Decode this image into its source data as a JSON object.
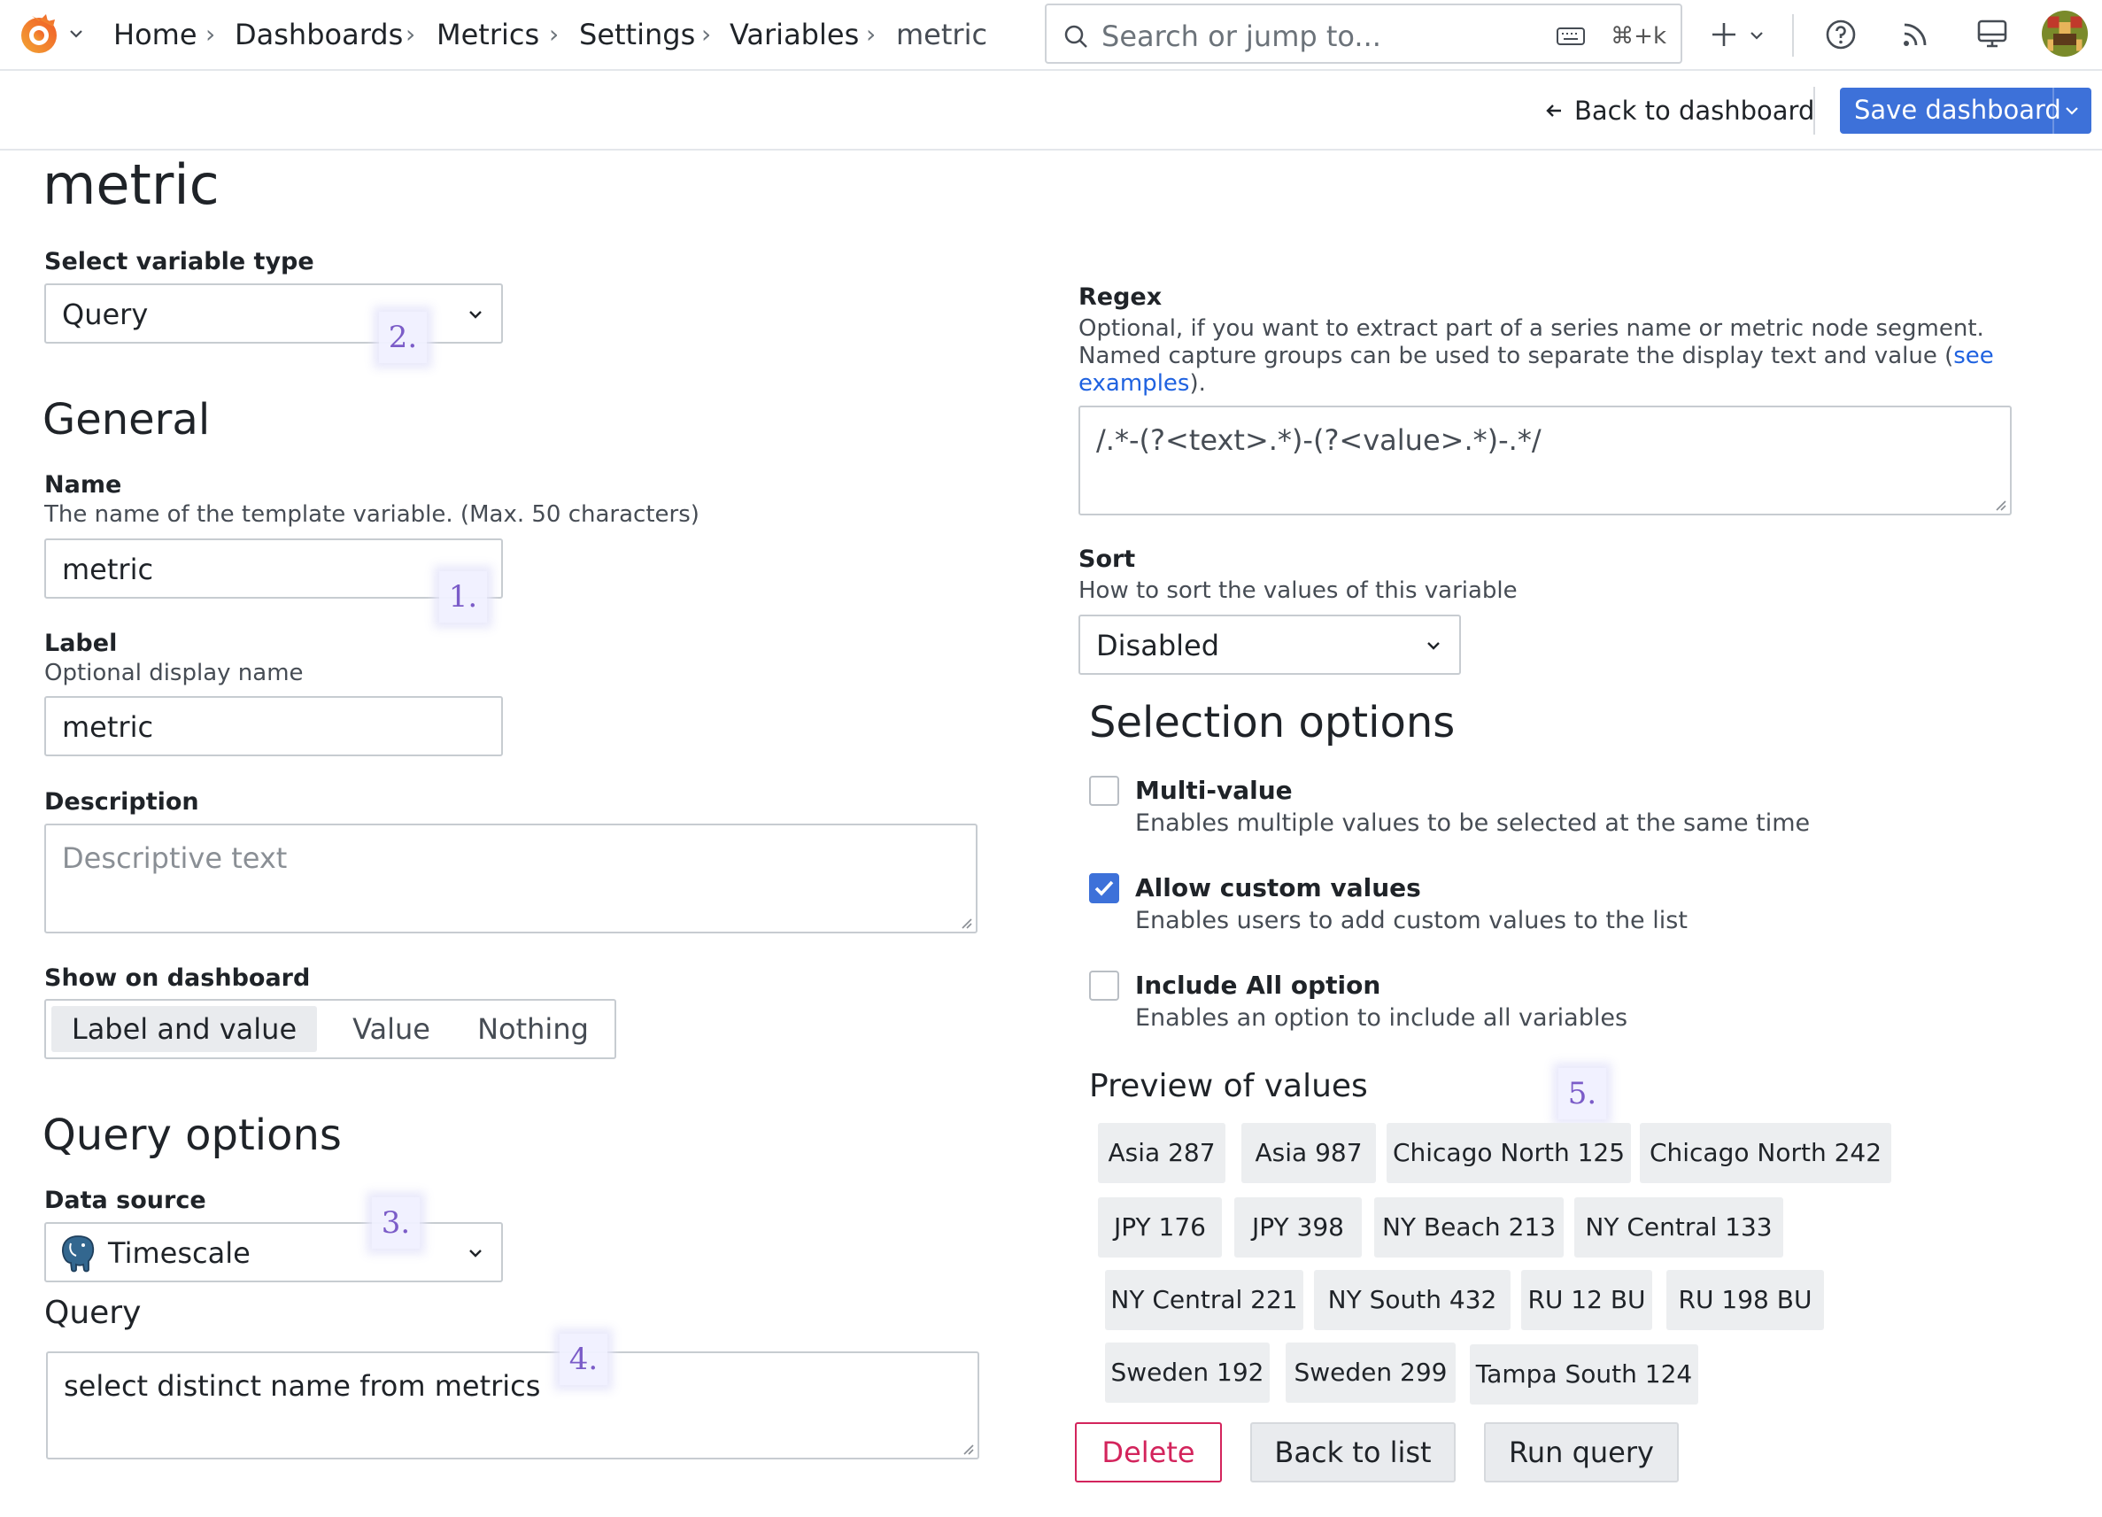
{
  "topbar": {
    "breadcrumbs": [
      "Home",
      "Dashboards",
      "Metrics",
      "Settings",
      "Variables",
      "metric"
    ],
    "search_placeholder": "Search or jump to...",
    "search_shortcut": "⌘+k"
  },
  "subbar": {
    "back_label": "Back to dashboard",
    "save_label": "Save dashboard"
  },
  "page": {
    "title": "metric"
  },
  "variable_type": {
    "label": "Select variable type",
    "value": "Query"
  },
  "general": {
    "heading": "General",
    "name": {
      "label": "Name",
      "description": "The name of the template variable. (Max. 50 characters)",
      "value": "metric"
    },
    "label": {
      "label": "Label",
      "description": "Optional display name",
      "value": "metric"
    },
    "description": {
      "label": "Description",
      "placeholder": "Descriptive text"
    },
    "show_on_dashboard": {
      "label": "Show on dashboard",
      "options": [
        "Label and value",
        "Value",
        "Nothing"
      ],
      "selected": "Label and value"
    }
  },
  "query_options": {
    "heading": "Query options",
    "data_source": {
      "label": "Data source",
      "value": "Timescale"
    },
    "query": {
      "label": "Query",
      "value": "select distinct name from metrics"
    }
  },
  "regex": {
    "label": "Regex",
    "description_line1": "Optional, if you want to extract part of a series name or metric node segment.",
    "description_line2": "Named capture groups can be used to separate the display text and value (",
    "link_see": "see",
    "link_examples": "examples",
    "description_end": ").",
    "value": "/.*-(?<text>.*)-(?<value>.*)-.*/"
  },
  "sort": {
    "label": "Sort",
    "description": "How to sort the values of this variable",
    "value": "Disabled"
  },
  "selection_options": {
    "heading": "Selection options",
    "multi_value": {
      "title": "Multi-value",
      "description": "Enables multiple values to be selected at the same time",
      "checked": false
    },
    "custom_values": {
      "title": "Allow custom values",
      "description": "Enables users to add custom values to the list",
      "checked": true
    },
    "include_all": {
      "title": "Include All option",
      "description": "Enables an option to include all variables",
      "checked": false
    }
  },
  "preview": {
    "heading": "Preview of values",
    "values": [
      "Asia 287",
      "Asia 987",
      "Chicago North 125",
      "Chicago North 242",
      "JPY 176",
      "JPY 398",
      "NY Beach 213",
      "NY Central 133",
      "NY Central 221",
      "NY South 432",
      "RU 12 BU",
      "RU 198 BU",
      "Sweden 192",
      "Sweden 299",
      "Tampa South 124"
    ]
  },
  "actions": {
    "delete": "Delete",
    "back_to_list": "Back to list",
    "run_query": "Run query"
  },
  "markers": [
    "1.",
    "2.",
    "3.",
    "4.",
    "5."
  ],
  "colors": {
    "primary": "#3d71d9",
    "danger": "#d3245c",
    "marker": "#7b5cc8",
    "link": "#1f62e0"
  }
}
